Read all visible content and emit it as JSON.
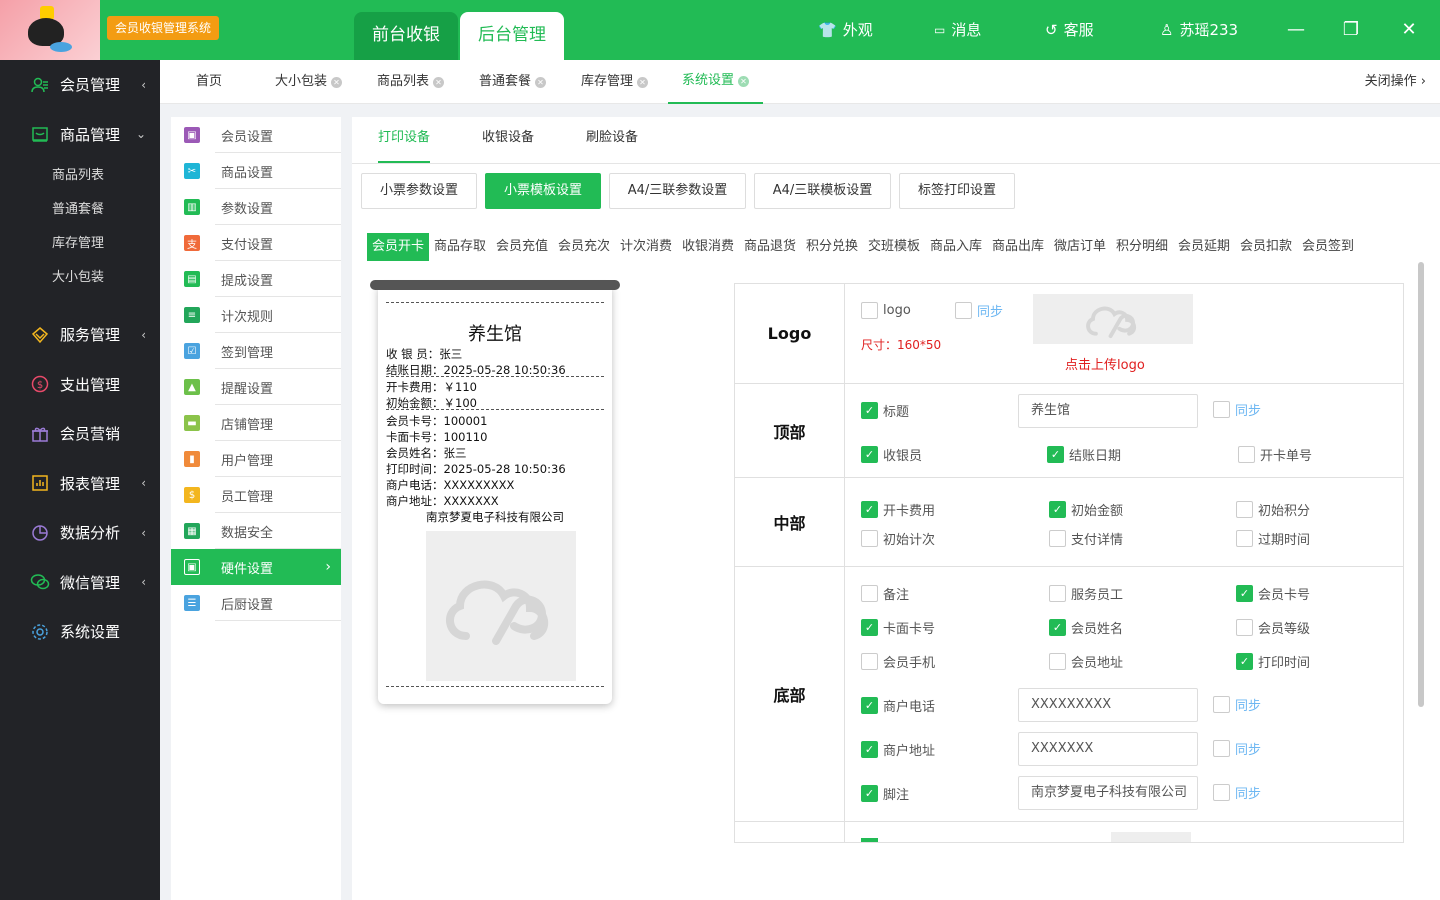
{
  "header": {
    "app_badge": "会员收银管理系统",
    "main_tabs": [
      "前台收银",
      "后台管理"
    ],
    "menu": {
      "appearance": "外观",
      "messages": "消息",
      "service": "客服",
      "user": "苏瑶233"
    }
  },
  "sidebar": {
    "items": [
      {
        "label": "会员管理",
        "icon": "users-icon",
        "arrow": "‹"
      },
      {
        "label": "商品管理",
        "icon": "shop-icon",
        "arrow": "⌄"
      },
      {
        "label": "服务管理",
        "icon": "diamond-icon",
        "arrow": "‹"
      },
      {
        "label": "支出管理",
        "icon": "dollar-icon",
        "arrow": ""
      },
      {
        "label": "会员营销",
        "icon": "gift-icon",
        "arrow": ""
      },
      {
        "label": "报表管理",
        "icon": "report-icon",
        "arrow": "‹"
      },
      {
        "label": "数据分析",
        "icon": "pie-chart-icon",
        "arrow": "‹"
      },
      {
        "label": "微信管理",
        "icon": "wechat-icon",
        "arrow": "‹"
      },
      {
        "label": "系统设置",
        "icon": "gear-icon",
        "arrow": ""
      }
    ],
    "sub_items": [
      "商品列表",
      "普通套餐",
      "库存管理",
      "大小包装"
    ]
  },
  "page_tabs": {
    "items": [
      "首页",
      "大小包装",
      "商品列表",
      "普通套餐",
      "库存管理",
      "系统设置"
    ],
    "close_ops": "关闭操作"
  },
  "settings_nav": {
    "items": [
      {
        "label": "会员设置",
        "color": "#9b59b6"
      },
      {
        "label": "商品设置",
        "color": "#1fb5d6"
      },
      {
        "label": "参数设置",
        "color": "#22bb55"
      },
      {
        "label": "支付设置",
        "color": "#f06a3a"
      },
      {
        "label": "提成设置",
        "color": "#22bb55"
      },
      {
        "label": "计次规则",
        "color": "#22a65a"
      },
      {
        "label": "签到管理",
        "color": "#4aa3df"
      },
      {
        "label": "提醒设置",
        "color": "#6cc04a"
      },
      {
        "label": "店铺管理",
        "color": "#8bc34a"
      },
      {
        "label": "用户管理",
        "color": "#f08a3a"
      },
      {
        "label": "员工管理",
        "color": "#f3b61f"
      },
      {
        "label": "数据安全",
        "color": "#22a65a"
      },
      {
        "label": "硬件设置",
        "color": "#f08a3a"
      },
      {
        "label": "后厨设置",
        "color": "#4aa3df"
      }
    ]
  },
  "device_tabs": [
    "打印设备",
    "收银设备",
    "刷脸设备"
  ],
  "buttons": [
    "小票参数设置",
    "小票模板设置",
    "A4/三联参数设置",
    "A4/三联模板设置",
    "标签打印设置"
  ],
  "templates": [
    "会员开卡",
    "商品存取",
    "会员充值",
    "会员充次",
    "计次消费",
    "收银消费",
    "商品退货",
    "积分兑换",
    "交班模板",
    "商品入库",
    "商品出库",
    "微店订单",
    "积分明细",
    "会员延期",
    "会员扣款",
    "会员签到"
  ],
  "receipt": {
    "title": "养生馆",
    "lines": [
      "收 银 员：张三",
      "结账日期：2025-05-28 10:50:36",
      "开卡费用：￥110",
      "初始金额：￥100",
      "会员卡号：100001",
      "卡面卡号：100110",
      "会员姓名：张三",
      "打印时间：2025-05-28 10:50:36",
      "商户电话：XXXXXXXXX",
      "商户地址：XXXXXXX"
    ],
    "footer": "南京梦夏电子科技有限公司"
  },
  "settings": {
    "logo": {
      "label": "Logo",
      "cb_logo": "logo",
      "sync": "同步",
      "size": "尺寸：160*50",
      "upload": "点击上传logo"
    },
    "top": {
      "label": "顶部",
      "title_cb": "标题",
      "title_value": "养生馆",
      "sync": "同步",
      "cashier": "收银员",
      "settle_date": "结账日期",
      "open_no": "开卡单号"
    },
    "middle": {
      "label": "中部",
      "items": [
        "开卡费用",
        "初始金额",
        "初始积分",
        "初始计次",
        "支付详情",
        "过期时间"
      ]
    },
    "bottom": {
      "label": "底部",
      "items": [
        "备注",
        "服务员工",
        "会员卡号",
        "卡面卡号",
        "会员姓名",
        "会员等级",
        "会员手机",
        "会员地址",
        "打印时间"
      ],
      "phone": "商户电话",
      "phone_value": "XXXXXXXXX",
      "address": "商户地址",
      "address_value": "XXXXXXX",
      "footer": "脚注",
      "footer_value": "南京梦夏电子科技有限公司",
      "sync": "同步"
    }
  },
  "colors": {
    "accent": "#22bb55",
    "sidebar_bg": "#222327",
    "sync": "#6db7f2",
    "warning": "#e02020"
  }
}
